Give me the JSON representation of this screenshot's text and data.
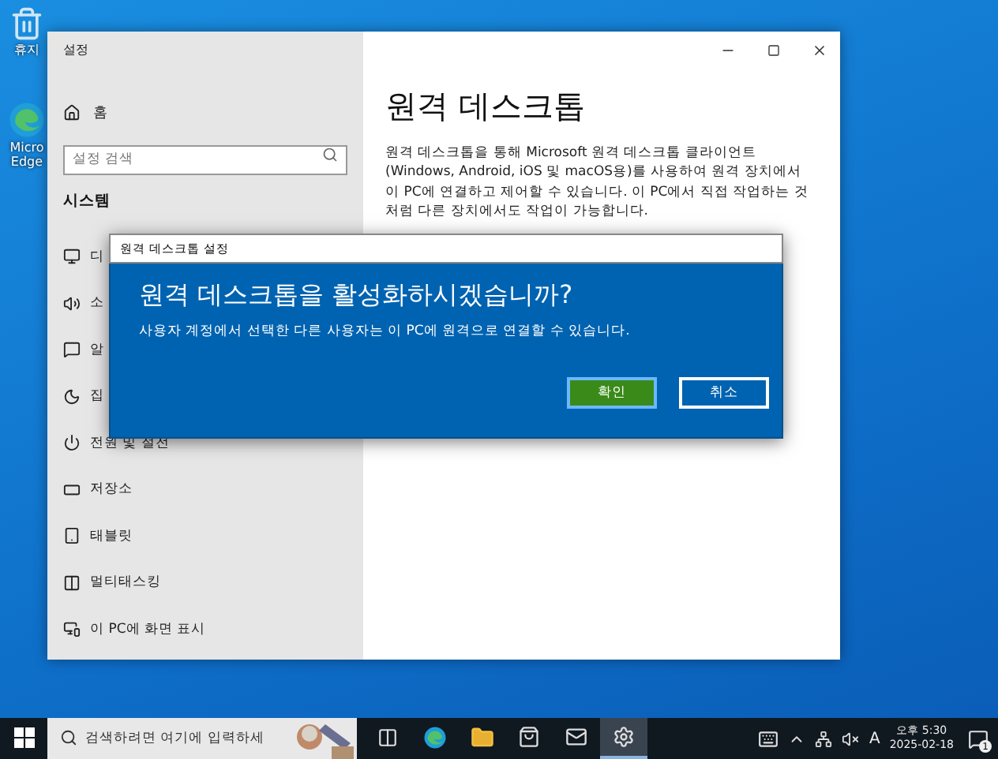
{
  "desktop_icons": [
    {
      "kind": "recycle",
      "label": "휴지"
    },
    {
      "kind": "edge",
      "label": "Micro\nEdge"
    }
  ],
  "window": {
    "title": "설정",
    "home": "홈",
    "search": {
      "placeholder": "설정 검색"
    },
    "section": "시스템",
    "items": [
      {
        "kind": "display",
        "label": "디"
      },
      {
        "kind": "sound",
        "label": "소"
      },
      {
        "kind": "notifications",
        "label": "알"
      },
      {
        "kind": "focus",
        "label": "집"
      },
      {
        "kind": "power",
        "label": "전원 및 절전"
      },
      {
        "kind": "storage",
        "label": "저장소"
      },
      {
        "kind": "tablet",
        "label": "태블릿"
      },
      {
        "kind": "multitasking",
        "label": "멀티태스킹"
      },
      {
        "kind": "projecting",
        "label": "이 PC에 화면 표시"
      }
    ]
  },
  "content": {
    "heading": "원격 데스크톱",
    "description": "원격 데스크톱을 통해 Microsoft 원격 데스크톱 클라이언트 (Windows, Android, iOS 및 macOS용)를 사용하여 원격 장치에서 이 PC에 연결하고 제어할 수 있습니다. 이 PC에서 직접 작업하는 것처럼 다른 장치에서도 작업이 가능합니다."
  },
  "dialog": {
    "title": "원격 데스크톱 설정",
    "heading": "원격 데스크톱을 활성화하시겠습니까?",
    "message": "사용자 계정에서 선택한 다른 사용자는 이 PC에 원격으로 연결할 수 있습니다.",
    "buttons": [
      {
        "label": "확인",
        "focused": true
      },
      {
        "label": "취소",
        "focused": false
      }
    ]
  },
  "taskbar": {
    "search": {
      "placeholder": "검색하려면 여기에 입력하세"
    },
    "apps": [
      {
        "kind": "taskview",
        "active": false
      },
      {
        "kind": "edge",
        "active": false
      },
      {
        "kind": "folder",
        "active": false
      },
      {
        "kind": "store",
        "active": false
      },
      {
        "kind": "mail",
        "active": false
      },
      {
        "kind": "settings",
        "active": true
      }
    ],
    "ime": "A",
    "time": "오후 5:30",
    "date": "2025-02-18",
    "notifications": "1"
  }
}
